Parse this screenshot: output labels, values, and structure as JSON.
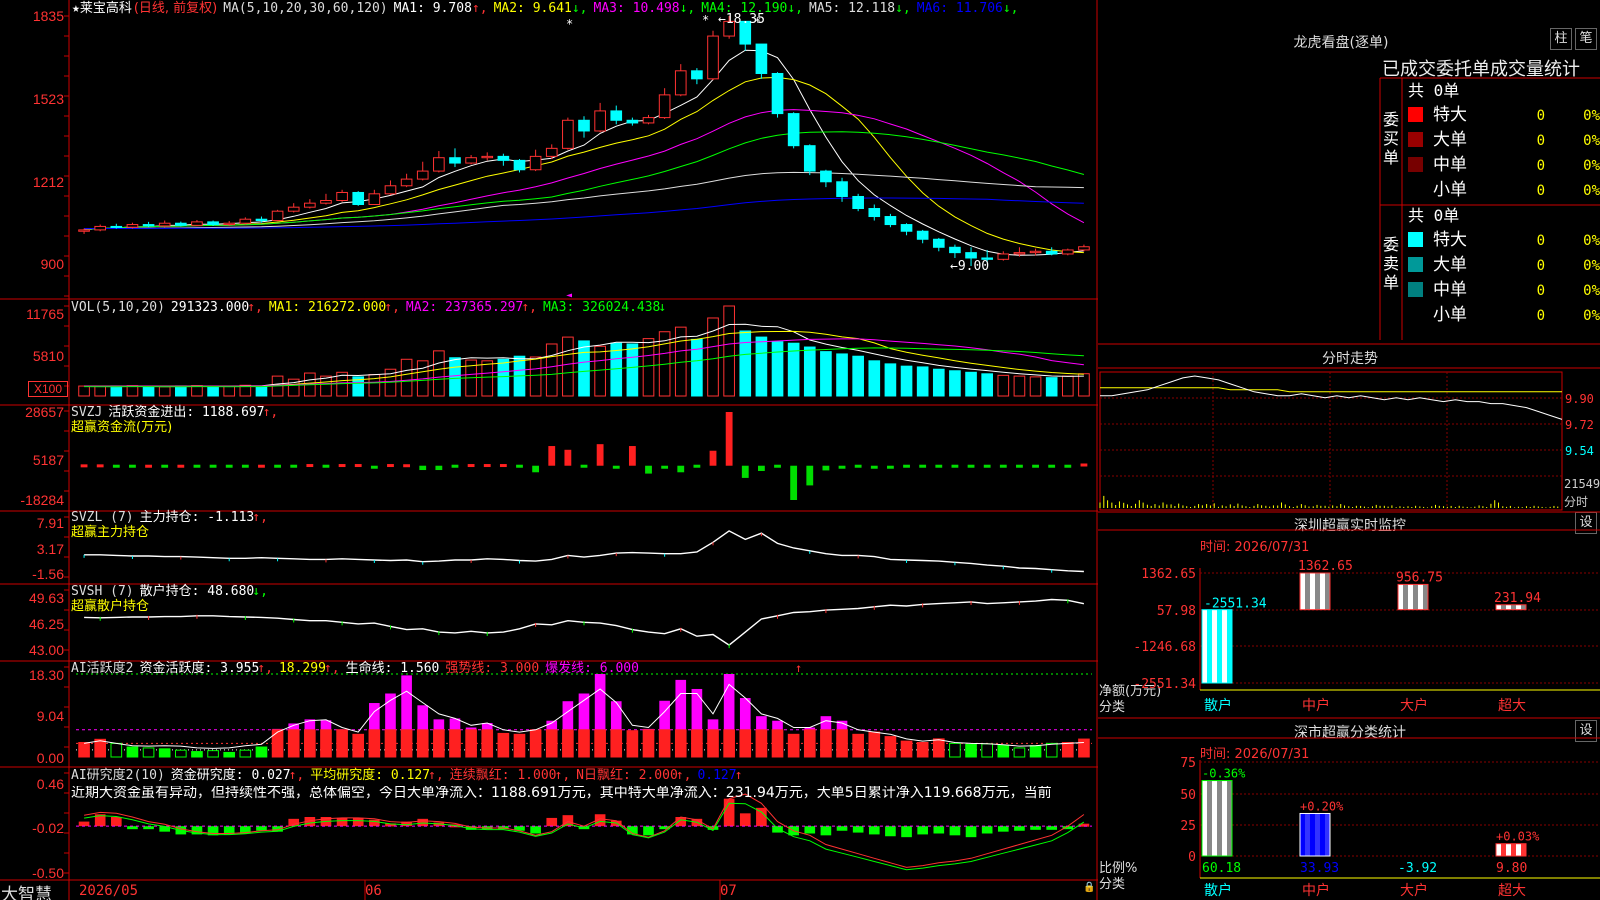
{
  "stock": {
    "name": "莱宝高科",
    "period": "(日线, 前复权)",
    "ma_label": "MA(5,10,20,30,60,120)",
    "ma": [
      {
        "label": "MA1: 9.708",
        "arrow": "↑",
        "color": "#ffffff"
      },
      {
        "label": "MA2: 9.641",
        "arrow": "↓",
        "color": "#ffff00"
      },
      {
        "label": "MA3: 10.498",
        "arrow": "↓",
        "color": "#ff00ff"
      },
      {
        "label": "MA4: 12.190",
        "arrow": "↓",
        "color": "#00ff00"
      },
      {
        "label": "MA5: 12.118",
        "arrow": "↓",
        "color": "#dddddd"
      },
      {
        "label": "MA6: 11.706",
        "arrow": "↓",
        "color": "#0000ff"
      }
    ],
    "high_mark": "18.35",
    "low_mark": "9.00",
    "price_axis": [
      "1835",
      "1523",
      "1212",
      "900"
    ]
  },
  "vol": {
    "header": "VOL(5,10,20)",
    "value": "291323.000",
    "ma1": "MA1: 216272.000",
    "ma2": "MA2: 237365.297",
    "ma3": "MA3: 326024.438",
    "axis": [
      "11765",
      "5810",
      "X100"
    ]
  },
  "svzj": {
    "name": "SVZJ",
    "label": "活跃资金进出: 1188.697",
    "sub": "超赢资金流(万元)",
    "axis": [
      "28657",
      "5187",
      "-18284"
    ]
  },
  "svzl": {
    "name": "SVZL (7)",
    "label": "主力持仓: -1.113",
    "sub": "超赢主力持仓",
    "axis": [
      "7.91",
      "3.17",
      "-1.56"
    ]
  },
  "svsh": {
    "name": "SVSH (7)",
    "label": "散户持仓: 48.680",
    "sub": "超赢散户持仓",
    "axis": [
      "49.63",
      "46.25",
      "43.00"
    ]
  },
  "ai1": {
    "name": "AI活跃度2",
    "label": "资金活跃度: 3.955",
    "v2": "18.299",
    "life": "生命线: 1.560",
    "strong": "强势线: 3.000",
    "burst": "爆发线: 6.000",
    "axis": [
      "18.30",
      "9.04",
      "0.00"
    ]
  },
  "ai2": {
    "name": "AI研究度2(10)",
    "label": "资金研究度: 0.027",
    "avg": "平均研究度: 0.127",
    "lian": "连续飘红: 1.000",
    "nday": "N日飘红: 2.000",
    "last": "0.127",
    "comment": "近期大资金虽有异动，但持续性不强，总体偏空，今日大单净流入：1188.691万元，其中特大单净流入：231.94万元，大单5日累计净入119.668万元，当前",
    "axis": [
      "0.46",
      "-0.02",
      "-0.50"
    ]
  },
  "footer": {
    "brand": "大智慧",
    "dates": [
      "2026/05",
      "06",
      "07"
    ]
  },
  "right": {
    "lhb_title": "龙虎看盘(逐单)",
    "btn_zhu": "柱",
    "btn_bi": "笔",
    "stat_title": "已成交委托单成交量统计",
    "buy_label": "委买单",
    "sell_label": "委卖单",
    "buy_total": "共 0单",
    "sell_total": "共 0单",
    "buy_rows": [
      {
        "name": "特大",
        "vol": "0",
        "pct": "0%",
        "color": "#ff0000"
      },
      {
        "name": "大单",
        "vol": "0",
        "pct": "0%",
        "color": "#990000"
      },
      {
        "name": "中单",
        "vol": "0",
        "pct": "0%",
        "color": "#770000"
      },
      {
        "name": "小单",
        "vol": "0",
        "pct": "0%",
        "color": ""
      }
    ],
    "sell_rows": [
      {
        "name": "特大",
        "vol": "0",
        "pct": "0%",
        "color": "#00ffff"
      },
      {
        "name": "大单",
        "vol": "0",
        "pct": "0%",
        "color": "#009999"
      },
      {
        "name": "中单",
        "vol": "0",
        "pct": "0%",
        "color": "#008080"
      },
      {
        "name": "小单",
        "vol": "0",
        "pct": "0%",
        "color": ""
      }
    ],
    "intraday_title": "分时走势",
    "intraday_axis": [
      "9.90",
      "9.72",
      "9.54"
    ],
    "intraday_vol": "21549",
    "intraday_unit": "分时",
    "monitor_title": "深圳超赢实时监控",
    "monitor_btn": "设",
    "monitor_time": "时间: 2026/07/31",
    "monitor_axis": [
      "1362.65",
      "57.98",
      "-1246.68",
      "-2551.34"
    ],
    "monitor_unit": "净额(万元)",
    "monitor_cat": "分类",
    "monitor_bars": [
      {
        "name": "散户",
        "value": -2551.34,
        "label": "-2551.34"
      },
      {
        "name": "中户",
        "value": 1362.65,
        "label": "1362.65"
      },
      {
        "name": "大户",
        "value": 956.75,
        "label": "956.75"
      },
      {
        "name": "超大",
        "value": 231.94,
        "label": "231.94"
      }
    ],
    "class_title": "深市超赢分类统计",
    "class_btn": "设",
    "class_time": "时间: 2026/07/31",
    "class_axis": [
      "75",
      "50",
      "25",
      "0"
    ],
    "class_unit": "比例%",
    "class_cat": "分类",
    "class_bars": [
      {
        "name": "散户",
        "pct": 60.18,
        "change": "-0.36%",
        "label": "60.18"
      },
      {
        "name": "中户",
        "pct": 33.93,
        "change": "+0.20%",
        "label": "33.93"
      },
      {
        "name": "大户",
        "pct": -3.92,
        "change": "",
        "label": "-3.92"
      },
      {
        "name": "超大",
        "pct": 9.8,
        "change": "+0.03%",
        "label": "9.80"
      }
    ]
  },
  "chart_data": {
    "type": "candlestick",
    "candles": [
      [
        10.3,
        10.35,
        10.2,
        10.4
      ],
      [
        10.35,
        10.48,
        10.3,
        10.55
      ],
      [
        10.48,
        10.45,
        10.4,
        10.58
      ],
      [
        10.45,
        10.55,
        10.4,
        10.62
      ],
      [
        10.55,
        10.5,
        10.45,
        10.65
      ],
      [
        10.5,
        10.6,
        10.45,
        10.7
      ],
      [
        10.6,
        10.52,
        10.48,
        10.66
      ],
      [
        10.52,
        10.65,
        10.5,
        10.72
      ],
      [
        10.65,
        10.55,
        10.5,
        10.7
      ],
      [
        10.55,
        10.6,
        10.5,
        10.68
      ],
      [
        10.6,
        10.75,
        10.55,
        10.82
      ],
      [
        10.75,
        10.7,
        10.62,
        10.85
      ],
      [
        10.7,
        11.05,
        10.68,
        11.1
      ],
      [
        11.05,
        11.2,
        11.0,
        11.35
      ],
      [
        11.2,
        11.35,
        11.15,
        11.5
      ],
      [
        11.35,
        11.45,
        11.3,
        11.7
      ],
      [
        11.45,
        11.75,
        11.4,
        11.85
      ],
      [
        11.75,
        11.3,
        11.25,
        11.8
      ],
      [
        11.3,
        11.7,
        11.28,
        11.85
      ],
      [
        11.7,
        12.0,
        11.65,
        12.2
      ],
      [
        12.0,
        12.25,
        11.95,
        12.45
      ],
      [
        12.25,
        12.55,
        12.2,
        12.9
      ],
      [
        12.55,
        13.05,
        12.5,
        13.3
      ],
      [
        13.05,
        12.85,
        12.7,
        13.4
      ],
      [
        12.85,
        13.05,
        12.8,
        13.15
      ],
      [
        13.05,
        13.1,
        12.95,
        13.25
      ],
      [
        13.1,
        12.95,
        12.75,
        13.2
      ],
      [
        12.95,
        12.6,
        12.5,
        13.0
      ],
      [
        12.6,
        13.1,
        12.55,
        13.35
      ],
      [
        13.1,
        13.4,
        13.0,
        13.55
      ],
      [
        13.4,
        14.45,
        13.35,
        14.55
      ],
      [
        14.45,
        14.05,
        13.8,
        14.6
      ],
      [
        14.05,
        14.8,
        14.0,
        15.1
      ],
      [
        14.8,
        14.45,
        14.3,
        15.0
      ],
      [
        14.45,
        14.35,
        14.25,
        14.55
      ],
      [
        14.35,
        14.55,
        14.3,
        14.65
      ],
      [
        14.55,
        15.4,
        14.5,
        15.65
      ],
      [
        15.4,
        16.3,
        15.35,
        16.55
      ],
      [
        16.3,
        16.0,
        15.8,
        16.4
      ],
      [
        16.0,
        17.6,
        15.95,
        17.8
      ],
      [
        17.6,
        18.15,
        17.5,
        18.35
      ],
      [
        18.15,
        17.3,
        17.05,
        17.55
      ],
      [
        17.3,
        16.2,
        16.0,
        16.3
      ],
      [
        16.2,
        14.7,
        14.55,
        16.25
      ],
      [
        14.7,
        13.5,
        13.4,
        14.75
      ],
      [
        13.5,
        12.55,
        12.4,
        13.55
      ],
      [
        12.55,
        12.15,
        11.95,
        12.6
      ],
      [
        12.15,
        11.6,
        11.4,
        12.3
      ],
      [
        11.6,
        11.15,
        11.05,
        11.7
      ],
      [
        11.15,
        10.85,
        10.7,
        11.3
      ],
      [
        10.85,
        10.55,
        10.45,
        10.95
      ],
      [
        10.55,
        10.3,
        10.15,
        10.6
      ],
      [
        10.3,
        10.0,
        9.85,
        10.35
      ],
      [
        10.0,
        9.7,
        9.55,
        10.05
      ],
      [
        9.7,
        9.5,
        9.3,
        9.8
      ],
      [
        9.5,
        9.3,
        9.0,
        9.7
      ],
      [
        9.3,
        9.25,
        9.15,
        9.6
      ],
      [
        9.25,
        9.45,
        9.2,
        9.55
      ],
      [
        9.45,
        9.5,
        9.35,
        9.7
      ],
      [
        9.5,
        9.55,
        9.4,
        9.65
      ],
      [
        9.55,
        9.45,
        9.4,
        9.7
      ],
      [
        9.45,
        9.6,
        9.4,
        9.65
      ],
      [
        9.6,
        9.72,
        9.55,
        9.8
      ]
    ],
    "volume": [
      1300,
      1250,
      1300,
      1350,
      1250,
      1200,
      1300,
      1350,
      1300,
      1250,
      1400,
      1300,
      2600,
      2200,
      3000,
      2600,
      3100,
      2500,
      2800,
      3500,
      4800,
      4600,
      5900,
      5000,
      4700,
      4600,
      4800,
      5200,
      5100,
      6800,
      7700,
      7200,
      6500,
      6900,
      6800,
      7500,
      8400,
      9000,
      7400,
      10200,
      11765,
      8500,
      7700,
      7100,
      6900,
      6400,
      5800,
      5500,
      5200,
      4600,
      4200,
      3900,
      3800,
      3500,
      3300,
      3100,
      2900,
      2700,
      2600,
      2500,
      2400,
      2600,
      2913
    ],
    "flow": [
      200,
      200,
      -300,
      -300,
      0,
      -300,
      0,
      -300,
      -300,
      -200,
      -300,
      0,
      -200,
      -200,
      900,
      -200,
      900,
      900,
      -1200,
      900,
      800,
      -2300,
      -2300,
      -200,
      900,
      900,
      900,
      -200,
      -3500,
      10500,
      8500,
      -200,
      11500,
      -1200,
      10500,
      -4200,
      -1500,
      -3500,
      -300,
      8000,
      28657,
      -6500,
      -2800,
      -200,
      -18284,
      -10500,
      -2500,
      -1200,
      -300,
      -900,
      -800,
      -300,
      -200,
      -300,
      -200,
      -200,
      -300,
      -200,
      -200,
      -200,
      -200,
      -200,
      1188
    ],
    "main_pos": [
      1.8,
      1.8,
      1.7,
      1.6,
      1.6,
      1.5,
      1.5,
      1.4,
      1.3,
      1.2,
      1.2,
      1.3,
      1.2,
      1.1,
      1.0,
      1.0,
      1.1,
      1.0,
      0.9,
      0.8,
      0.9,
      0.6,
      0.7,
      0.9,
      0.9,
      1.1,
      1.0,
      0.8,
      0.7,
      1.0,
      1.7,
      1.4,
      1.7,
      2.1,
      2.2,
      2.1,
      2.0,
      2.0,
      2.3,
      4.0,
      6.0,
      4.5,
      5.6,
      3.8,
      3.0,
      2.5,
      2.0,
      1.7,
      1.7,
      1.5,
      1.0,
      0.9,
      0.8,
      0.7,
      0.5,
      0.3,
      0.0,
      -0.2,
      -0.5,
      -0.6,
      -0.8,
      -1.0,
      -1.113
    ],
    "retail_pos": [
      47.0,
      46.95,
      47.0,
      47.05,
      47.05,
      47.1,
      47.1,
      47.2,
      47.2,
      47.1,
      47.05,
      47.0,
      46.9,
      46.75,
      46.6,
      46.6,
      46.4,
      46.2,
      46.3,
      45.9,
      45.5,
      45.6,
      45.2,
      45.1,
      45.3,
      45.1,
      45.2,
      45.6,
      46.2,
      46.1,
      46.6,
      46.4,
      46.3,
      46.0,
      45.5,
      45.2,
      45.0,
      45.6,
      44.7,
      44.9,
      43.6,
      45.2,
      46.8,
      47.2,
      47.6,
      47.7,
      47.9,
      48.0,
      48.1,
      48.3,
      48.5,
      48.4,
      48.6,
      48.7,
      48.8,
      48.9,
      48.7,
      48.8,
      48.9,
      49.0,
      49.2,
      49.1,
      48.68
    ],
    "activity": [
      3.2,
      3.9,
      3.0,
      2.2,
      2.0,
      1.8,
      1.5,
      1.2,
      1.4,
      1.0,
      1.5,
      2.2,
      6.2,
      7.4,
      8.3,
      8.1,
      6.1,
      5.0,
      11.9,
      14.0,
      18.0,
      11.4,
      8.3,
      8.5,
      6.5,
      7.5,
      5.2,
      5.0,
      6.0,
      8.0,
      12.3,
      14.0,
      18.3,
      12.3,
      5.8,
      6.2,
      12.4,
      17.0,
      15.0,
      8.3,
      18.3,
      13.0,
      9.0,
      8.0,
      5.0,
      6.5,
      9.0,
      8.0,
      5.0,
      5.5,
      4.5,
      3.5,
      3.2,
      4.0,
      3.0,
      2.8,
      2.9,
      2.6,
      2.0,
      2.5,
      3.0,
      3.2,
      3.955
    ],
    "activity2": [
      3.0,
      3.6,
      3.0,
      2.5,
      2.4,
      2.5,
      2.4,
      2.0,
      1.9,
      2.0,
      2.5,
      2.8,
      5.5,
      7.0,
      8.0,
      8.2,
      6.5,
      5.5,
      10.0,
      12.5,
      14.5,
      12.0,
      9.5,
      8.5,
      7.0,
      7.5,
      6.0,
      5.5,
      6.0,
      7.5,
      10.0,
      12.5,
      15.0,
      12.0,
      7.0,
      6.5,
      10.0,
      14.0,
      14.0,
      9.5,
      16.0,
      13.0,
      9.5,
      8.5,
      6.5,
      6.5,
      8.0,
      7.5,
      6.0,
      5.5,
      5.0,
      4.0,
      3.5,
      3.8,
      3.2,
      3.0,
      2.9,
      2.7,
      2.4,
      2.5,
      2.8,
      3.0,
      3.2
    ],
    "research": [
      0.05,
      0.13,
      0.1,
      -0.02,
      -0.02,
      -0.06,
      -0.09,
      -0.09,
      -0.1,
      -0.09,
      -0.08,
      -0.05,
      -0.06,
      0.08,
      0.1,
      0.1,
      0.09,
      0.09,
      0.07,
      0.03,
      0.05,
      0.08,
      0.04,
      0.02,
      -0.04,
      -0.03,
      -0.02,
      -0.05,
      -0.08,
      0.09,
      0.12,
      -0.03,
      0.13,
      0.06,
      -0.09,
      -0.1,
      -0.02,
      0.1,
      0.08,
      -0.04,
      0.3,
      0.14,
      0.2,
      -0.07,
      -0.1,
      -0.08,
      -0.1,
      -0.05,
      -0.07,
      -0.09,
      -0.11,
      -0.12,
      -0.09,
      -0.08,
      -0.1,
      -0.12,
      -0.08,
      -0.06,
      -0.05,
      -0.04,
      -0.04,
      -0.03,
      0.027
    ],
    "research_avg": [
      0.12,
      0.15,
      0.14,
      0.1,
      0.05,
      0.02,
      -0.03,
      -0.06,
      -0.08,
      -0.08,
      -0.07,
      -0.05,
      -0.04,
      0.02,
      0.06,
      0.08,
      0.09,
      0.09,
      0.08,
      0.05,
      0.04,
      0.06,
      0.05,
      0.03,
      -0.01,
      -0.02,
      -0.02,
      -0.05,
      -0.1,
      -0.06,
      0.05,
      0.0,
      0.08,
      0.06,
      -0.08,
      -0.12,
      -0.05,
      0.1,
      0.07,
      -0.03,
      0.3,
      0.35,
      0.25,
      0.05,
      -0.05,
      -0.1,
      -0.2,
      -0.25,
      -0.3,
      -0.35,
      -0.4,
      -0.45,
      -0.43,
      -0.4,
      -0.38,
      -0.35,
      -0.3,
      -0.25,
      -0.2,
      -0.15,
      -0.1,
      0.0,
      0.127
    ],
    "intraday": [
      9.84,
      9.84,
      9.85,
      9.86,
      9.87,
      9.89,
      9.91,
      9.93,
      9.94,
      9.93,
      9.92,
      9.9,
      9.88,
      9.86,
      9.85,
      9.84,
      9.84,
      9.85,
      9.84,
      9.83,
      9.84,
      9.83,
      9.84,
      9.83,
      9.82,
      9.83,
      9.82,
      9.83,
      9.82,
      9.81,
      9.82,
      9.81,
      9.81,
      9.8,
      9.8,
      9.79,
      9.78,
      9.76,
      9.74,
      9.72
    ],
    "intraday_avg": [
      9.88,
      9.88,
      9.88,
      9.88,
      9.88,
      9.88,
      9.88,
      9.88,
      9.88,
      9.88,
      9.88,
      9.87,
      9.87,
      9.87,
      9.87,
      9.87,
      9.86,
      9.86,
      9.86,
      9.86,
      9.86,
      9.86,
      9.86,
      9.86,
      9.86,
      9.86,
      9.86,
      9.86,
      9.86,
      9.86,
      9.86,
      9.86,
      9.86,
      9.86,
      9.86,
      9.86,
      9.86,
      9.86,
      9.86,
      9.86
    ],
    "intraday_vol": [
      0.55,
      0.3,
      0.2,
      0.3,
      0.15,
      0.25,
      0.2,
      0.1,
      0.15,
      0.18,
      0.12,
      0.2,
      0.1,
      0.15,
      0.1,
      0.25,
      0.1,
      0.15,
      0.12,
      0.1,
      0.18,
      0.1,
      0.08,
      0.12,
      0.1,
      0.08,
      0.1,
      0.06,
      0.12,
      0.08,
      0.1,
      0.06,
      0.1,
      0.3,
      0.08,
      0.06,
      0.1,
      0.06,
      0.08,
      0.05
    ],
    "price_range": [
      9.0,
      18.35
    ],
    "flow_range": [
      -18284,
      28657
    ]
  }
}
